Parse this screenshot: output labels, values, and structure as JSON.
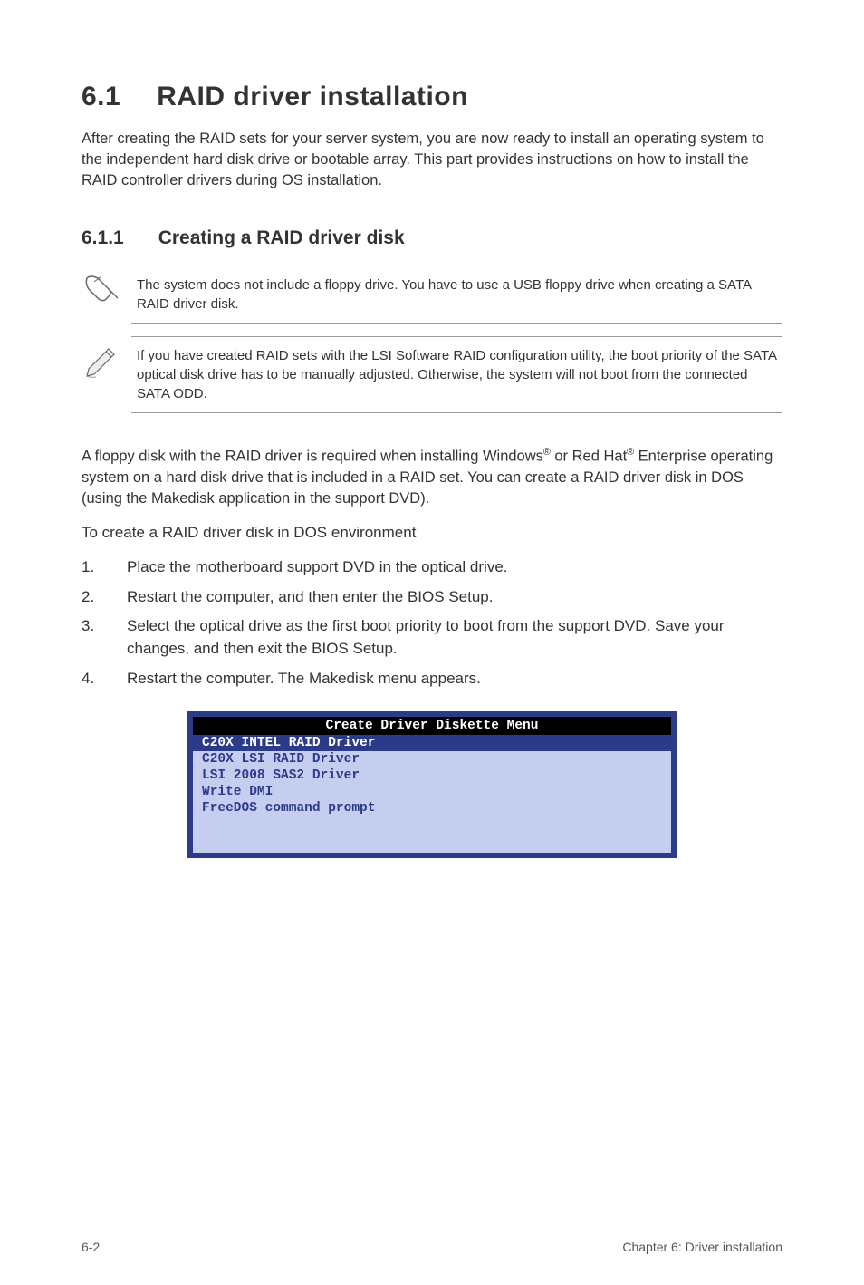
{
  "heading": {
    "number": "6.1",
    "title": "RAID driver installation"
  },
  "intro": "After creating the RAID sets for your server system, you are now ready to install an operating system to the independent hard disk drive or bootable array. This part provides instructions on how to install the RAID controller drivers during OS installation.",
  "subheading": {
    "number": "6.1.1",
    "title": "Creating a RAID driver disk"
  },
  "note1": "The system does not include a floppy drive. You have to use a USB floppy drive when creating a SATA RAID driver disk.",
  "note2": "If you have created RAID sets with the LSI Software RAID configuration utility, the boot priority of the SATA optical disk drive has to be manually adjusted. Otherwise, the system will not boot from the connected SATA ODD.",
  "body_para_parts": {
    "p1": "A floppy disk with the RAID driver is required when installing Windows",
    "p2": " or Red Hat",
    "p3": " Enterprise operating system on a hard disk drive that is included in a RAID set. You can create a RAID driver disk in DOS (using the Makedisk application in the support DVD)."
  },
  "to_create": "To create a RAID driver disk in DOS environment",
  "steps": [
    {
      "num": "1.",
      "text": "Place the motherboard support DVD in the optical drive."
    },
    {
      "num": "2.",
      "text": "Restart the computer, and then enter the BIOS Setup."
    },
    {
      "num": "3.",
      "text": "Select the optical drive as the first boot priority to boot from the support DVD. Save your changes, and then exit the BIOS Setup."
    },
    {
      "num": "4.",
      "text": "Restart the computer. The Makedisk menu appears."
    }
  ],
  "screenshot": {
    "title": "Create Driver Diskette Menu",
    "items": [
      {
        "label": "C20X INTEL RAID Driver",
        "selected": true
      },
      {
        "label": "C20X LSI RAID Driver",
        "selected": false
      },
      {
        "label": "LSI 2008 SAS2 Driver",
        "selected": false
      },
      {
        "label": "Write DMI",
        "selected": false
      },
      {
        "label": "FreeDOS command prompt",
        "selected": false
      }
    ]
  },
  "footer": {
    "left": "6-2",
    "right": "Chapter 6: Driver installation"
  }
}
